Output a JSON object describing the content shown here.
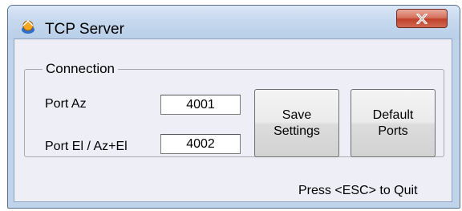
{
  "window": {
    "title": "TCP Server",
    "close_label": "✕"
  },
  "connection": {
    "group_label": "Connection",
    "port_az_label": "Port Az",
    "port_az_value": "4001",
    "port_el_label": "Port El / Az+El",
    "port_el_value": "4002"
  },
  "buttons": {
    "save_line1": "Save",
    "save_line2": "Settings",
    "default_line1": "Default",
    "default_line2": "Ports"
  },
  "status": {
    "quit_hint": "Press <ESC> to Quit"
  },
  "colors": {
    "title_bar": "#c5d8ee",
    "client_bg": "#eeeef7",
    "close_button": "#c0412b"
  }
}
